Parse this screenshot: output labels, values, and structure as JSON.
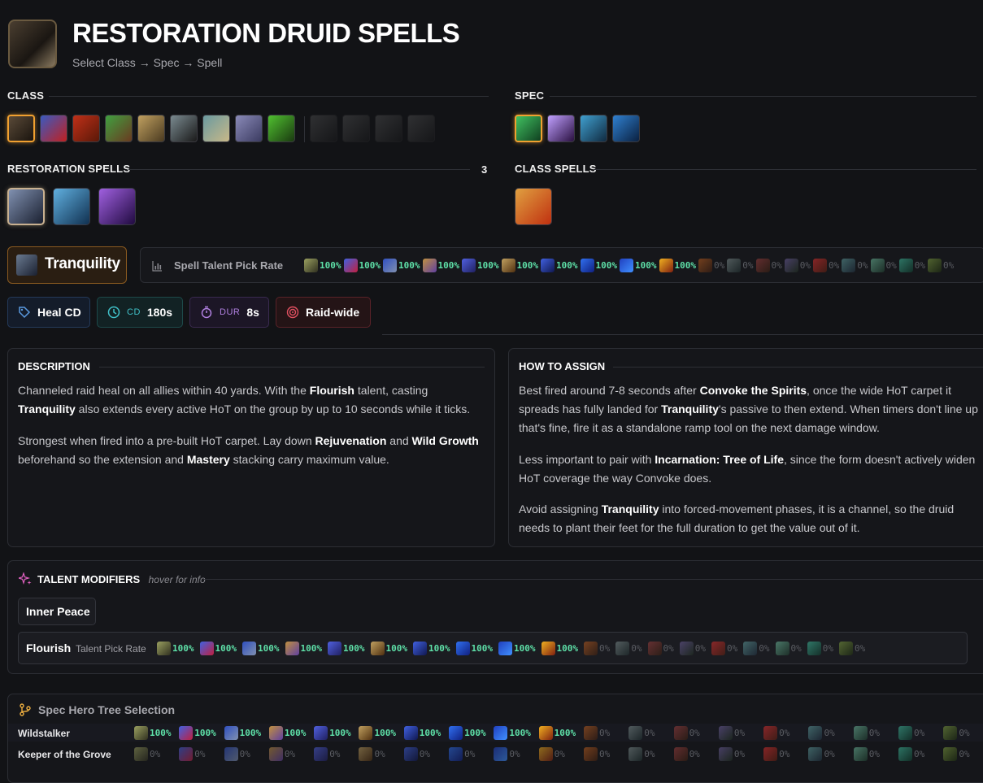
{
  "header": {
    "title": "RESTORATION DRUID SPELLS",
    "subtitle": "Select Class → Spec → Spell"
  },
  "sections": {
    "class": "CLASS",
    "spec": "SPEC",
    "spec_spells": "RESTORATION SPELLS",
    "spec_spells_count": "3",
    "class_spells": "CLASS SPELLS"
  },
  "class_icons": [
    {
      "name": "druid-class-icon",
      "colors": [
        "#5a4a38",
        "#1a140e"
      ],
      "selected": true
    },
    {
      "name": "evoker-class-icon",
      "colors": [
        "#3a5ac0",
        "#c02020"
      ]
    },
    {
      "name": "demon-hunter-class-icon",
      "colors": [
        "#c03018",
        "#5a1808"
      ]
    },
    {
      "name": "hunter-class-icon",
      "colors": [
        "#40a040",
        "#6a3a20"
      ]
    },
    {
      "name": "paladin-class-icon",
      "colors": [
        "#c0a060",
        "#4a3a20"
      ]
    },
    {
      "name": "rogue-class-icon",
      "colors": [
        "#7a8a90",
        "#1a1a1a"
      ]
    },
    {
      "name": "warrior-class-icon",
      "colors": [
        "#6a9aa0",
        "#c8b888"
      ]
    },
    {
      "name": "mage-class-icon",
      "colors": [
        "#8a8ab8",
        "#3a3a60"
      ]
    },
    {
      "name": "monk-class-icon",
      "colors": [
        "#50c030",
        "#1a3a10"
      ]
    },
    {
      "name": "priest-class-icon",
      "colors": [
        "#888",
        "#222"
      ],
      "dim": true
    },
    {
      "name": "shaman-class-icon",
      "colors": [
        "#888",
        "#222"
      ],
      "dim": true
    },
    {
      "name": "death-knight-class-icon",
      "colors": [
        "#888",
        "#222"
      ],
      "dim": true
    },
    {
      "name": "warlock-class-icon",
      "colors": [
        "#888",
        "#222"
      ],
      "dim": true
    }
  ],
  "spec_icons": [
    {
      "name": "restoration-spec-icon",
      "colors": [
        "#40c060",
        "#104020"
      ],
      "selected": true
    },
    {
      "name": "balance-spec-icon",
      "colors": [
        "#c0a0ff",
        "#2a1040"
      ]
    },
    {
      "name": "feral-spec-icon",
      "colors": [
        "#40a0d0",
        "#102a40"
      ]
    },
    {
      "name": "guardian-spec-icon",
      "colors": [
        "#3080d0",
        "#0a2040"
      ]
    }
  ],
  "spec_spell_icons": [
    {
      "name": "tranquility-spell-icon",
      "colors": [
        "#8090b0",
        "#1a2030"
      ],
      "selected": true
    },
    {
      "name": "flourish-spell-icon",
      "colors": [
        "#60b0e0",
        "#103050"
      ]
    },
    {
      "name": "incarnation-spell-icon",
      "colors": [
        "#a060e0",
        "#200a40"
      ]
    }
  ],
  "class_spell_icons": [
    {
      "name": "stampeding-roar-spell-icon",
      "colors": [
        "#e0a040",
        "#c03010"
      ]
    }
  ],
  "spell": {
    "name": "Tranquility",
    "pick_rate_label": "Spell Talent Pick Rate",
    "badges": {
      "type": "Heal CD",
      "cd_key": "CD",
      "cd_value": "180s",
      "dur_key": "DUR",
      "dur_value": "8s",
      "target": "Raid-wide"
    }
  },
  "pick_rates": [
    {
      "icon": "spec-1",
      "value": "100%",
      "colors": [
        "#9aa060",
        "#303020"
      ]
    },
    {
      "icon": "spec-2",
      "value": "100%",
      "colors": [
        "#4060e0",
        "#c02040"
      ]
    },
    {
      "icon": "spec-3",
      "value": "100%",
      "colors": [
        "#3050c0",
        "#8090b0"
      ]
    },
    {
      "icon": "spec-4",
      "value": "100%",
      "colors": [
        "#c09040",
        "#6040a0"
      ]
    },
    {
      "icon": "spec-5",
      "value": "100%",
      "colors": [
        "#5060e0",
        "#202060"
      ]
    },
    {
      "icon": "spec-6",
      "value": "100%",
      "colors": [
        "#c0a060",
        "#503010"
      ]
    },
    {
      "icon": "spec-7",
      "value": "100%",
      "colors": [
        "#4060e0",
        "#101850"
      ]
    },
    {
      "icon": "spec-8",
      "value": "100%",
      "colors": [
        "#3070f0",
        "#102080"
      ]
    },
    {
      "icon": "spec-9",
      "value": "100%",
      "colors": [
        "#2040c0",
        "#4090ff"
      ]
    },
    {
      "icon": "spec-10",
      "value": "100%",
      "colors": [
        "#f0b020",
        "#802010"
      ]
    },
    {
      "icon": "spec-11",
      "value": "0%",
      "colors": [
        "#c06020",
        "#402010"
      ]
    },
    {
      "icon": "spec-12",
      "value": "0%",
      "colors": [
        "#809090",
        "#203030"
      ]
    },
    {
      "icon": "spec-13",
      "value": "0%",
      "colors": [
        "#a04040",
        "#3a2010"
      ]
    },
    {
      "icon": "spec-14",
      "value": "0%",
      "colors": [
        "#7060a0",
        "#203020"
      ]
    },
    {
      "icon": "spec-15",
      "value": "0%",
      "colors": [
        "#e03030",
        "#602010"
      ]
    },
    {
      "icon": "spec-16",
      "value": "0%",
      "colors": [
        "#60a0a0",
        "#203040"
      ]
    },
    {
      "icon": "spec-17",
      "value": "0%",
      "colors": [
        "#70c0a0",
        "#204030"
      ]
    },
    {
      "icon": "spec-18",
      "value": "0%",
      "colors": [
        "#40c0a0",
        "#104030"
      ]
    },
    {
      "icon": "spec-19",
      "value": "0%",
      "colors": [
        "#80a040",
        "#203010"
      ]
    }
  ],
  "description": {
    "title": "DESCRIPTION",
    "p1": [
      {
        "t": "Channeled raid heal on all allies within 40 yards. With the "
      },
      {
        "t": "Flourish",
        "b": true
      },
      {
        "t": " talent, casting "
      },
      {
        "t": "Tranquility",
        "b": true
      },
      {
        "t": " also extends every active HoT on the group by up to 10 seconds while it ticks."
      }
    ],
    "p2": [
      {
        "t": "Strongest when fired into a pre-built HoT carpet. Lay down "
      },
      {
        "t": "Rejuvenation",
        "b": true
      },
      {
        "t": " and "
      },
      {
        "t": "Wild Growth",
        "b": true
      },
      {
        "t": " beforehand so the extension and "
      },
      {
        "t": "Mastery",
        "b": true
      },
      {
        "t": " stacking carry maximum value."
      }
    ]
  },
  "how_to": {
    "title": "HOW TO ASSIGN",
    "p1": [
      {
        "t": "Best fired around 7-8 seconds after "
      },
      {
        "t": "Convoke the Spirits",
        "b": true
      },
      {
        "t": ", once the wide HoT carpet it spreads has fully landed for "
      },
      {
        "t": "Tranquility",
        "b": true
      },
      {
        "t": "'s passive to then extend. When timers don't line up that's fine, fire it as a standalone ramp tool on the next damage window."
      }
    ],
    "p2": [
      {
        "t": "Less important to pair with "
      },
      {
        "t": "Incarnation: Tree of Life",
        "b": true
      },
      {
        "t": ", since the form doesn't actively widen HoT coverage the way Convoke does."
      }
    ],
    "p3": [
      {
        "t": "Avoid assigning "
      },
      {
        "t": "Tranquility",
        "b": true
      },
      {
        "t": " into forced-movement phases, it is a channel, so the druid needs to plant their feet for the full duration to get the value out of it."
      }
    ]
  },
  "talent_modifiers": {
    "title": "TALENT MODIFIERS",
    "hint": "hover for info",
    "tag": "Inner Peace",
    "row_name": "Flourish",
    "row_label": "Talent Pick Rate"
  },
  "hero": {
    "title": "Spec Hero Tree Selection",
    "rows": [
      {
        "label": "Wildstalker",
        "values": [
          "100%",
          "100%",
          "100%",
          "100%",
          "100%",
          "100%",
          "100%",
          "100%",
          "100%",
          "100%",
          "0%",
          "0%",
          "0%",
          "0%",
          "0%",
          "0%",
          "0%",
          "0%",
          "0%"
        ]
      },
      {
        "label": "Keeper of the Grove",
        "values": [
          "0%",
          "0%",
          "0%",
          "0%",
          "0%",
          "0%",
          "0%",
          "0%",
          "0%",
          "0%",
          "0%",
          "0%",
          "0%",
          "0%",
          "0%",
          "0%",
          "0%",
          "0%",
          "0%"
        ]
      }
    ]
  },
  "colors": {
    "accent": "#f0a030",
    "positive": "#5ee0a8",
    "muted": "#5a5c62"
  }
}
